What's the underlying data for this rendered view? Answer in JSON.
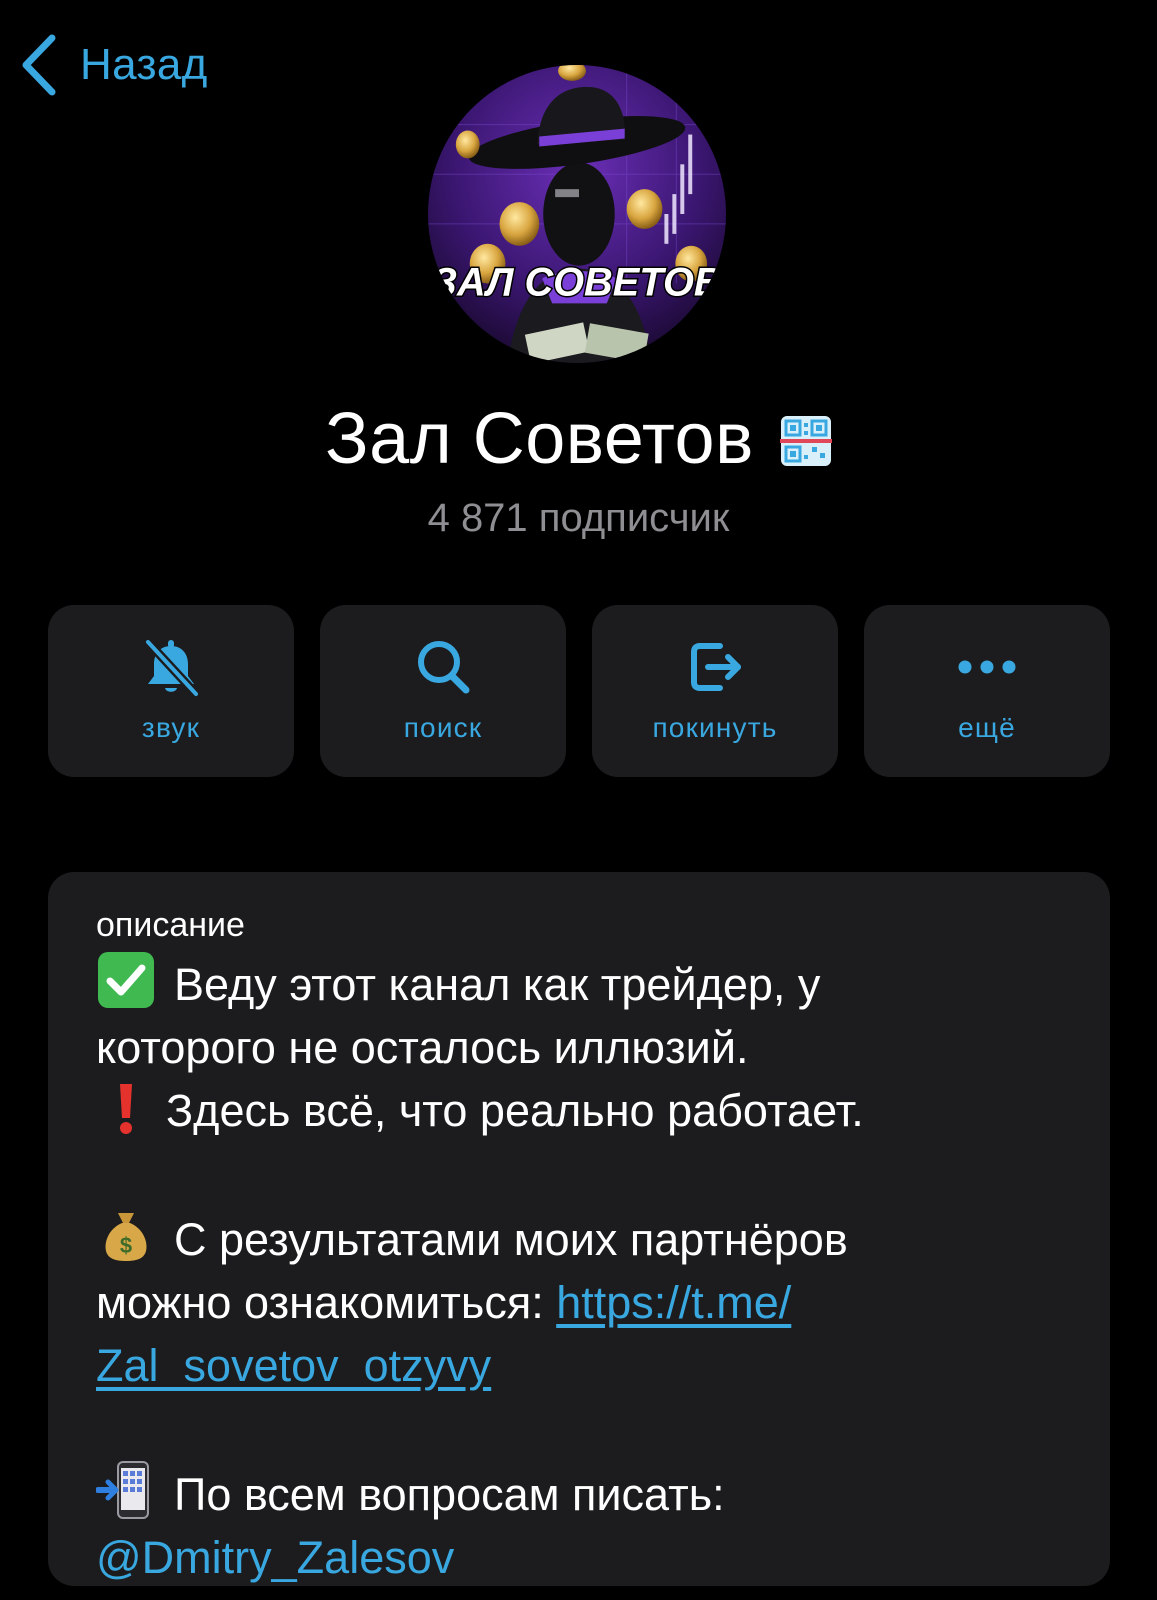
{
  "header": {
    "back_label": "Назад"
  },
  "channel": {
    "title": "Зал Советов",
    "subscribers": "4 871 подписчик",
    "avatar_text": "ЗАЛ СОВЕТОВ"
  },
  "actions": [
    {
      "label": "звук",
      "icon": "bell-slash-icon"
    },
    {
      "label": "поиск",
      "icon": "search-icon"
    },
    {
      "label": "покинуть",
      "icon": "leave-icon"
    },
    {
      "label": "ещё",
      "icon": "more-icon"
    }
  ],
  "description": {
    "label": "описание",
    "line1": "Веду этот канал как трейдер, у",
    "line2": "которого не осталось иллюзий.",
    "line3": "Здесь всё, что реально работает.",
    "line4": "С результатами моих партнёров",
    "line5_text": "можно ознакомиться: ",
    "link_part1": "https://t.me/",
    "link_part2": "Zal_sovetov_otzyvy",
    "line7": "По всем вопросам писать:",
    "mention": "@Dmitry_Zalesov"
  },
  "colors": {
    "accent": "#3aa8e0",
    "background": "#000000",
    "card": "#1c1c1e",
    "secondary_text": "#8e8e93"
  }
}
